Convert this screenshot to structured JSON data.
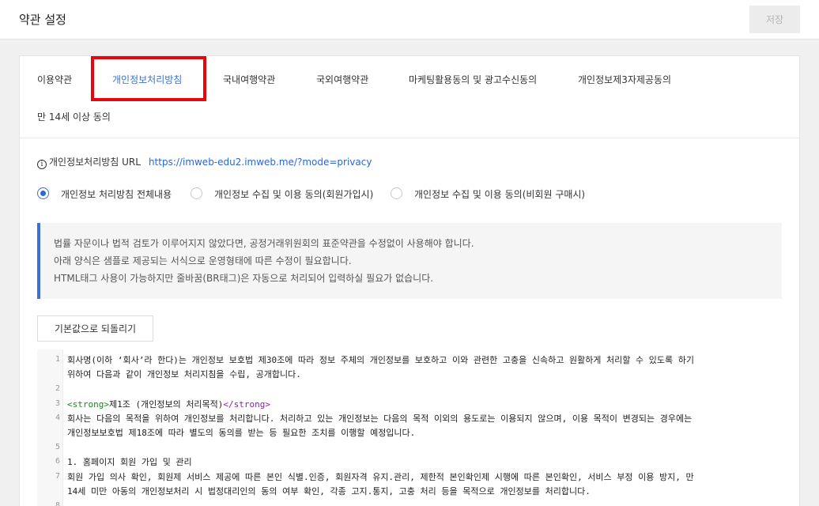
{
  "header": {
    "title": "약관 설정",
    "save_label": "저장"
  },
  "tabs": [
    {
      "label": "이용약관"
    },
    {
      "label": "개인정보처리방침"
    },
    {
      "label": "국내여행약관"
    },
    {
      "label": "국외여행약관"
    },
    {
      "label": "마케팅활용동의 및 광고수신동의"
    },
    {
      "label": "개인정보제3자제공동의"
    },
    {
      "label": "만 14세 이상 동의"
    }
  ],
  "policy_url": {
    "label": "개인정보처리방침 URL",
    "info_glyph": "i",
    "link": "https://imweb-edu2.imweb.me/?mode=privacy"
  },
  "radio_options": [
    {
      "label": "개인정보 처리방침 전체내용"
    },
    {
      "label": "개인정보 수집 및 이용 동의(회원가입시)"
    },
    {
      "label": "개인정보 수집 및 이용 동의(비회원 구매시)"
    }
  ],
  "notice_lines": [
    "법률 자문이나 법적 검토가 이루어지지 않았다면, 공정거래위원회의 표준약관을 수정없이 사용해야 합니다.",
    "아래 양식은 샘플로 제공되는 서식으로 운영형태에 따른 수정이 필요합니다.",
    "HTML태그 사용이 가능하지만 줄바꿈(BR태그)은 자동으로 처리되어 입력하실 필요가 없습니다."
  ],
  "reset_label": "기본값으로 되돌리기",
  "editor": {
    "line_numbers": [
      "1",
      "2",
      "3",
      "4",
      "5",
      "6",
      "7",
      "8"
    ],
    "line1a": "회사명(이하 ‘회사’라 한다)는 개인정보 보호법 제30조에 따라 정보 주체의 개인정보를 보호하고 이와 관련한 고충을 신속하고 원활하게 처리할 수 있도록 하기",
    "line1b": "위하여 다음과 같이 개인정보 처리지침을 수립, 공개합니다.",
    "line3_open": "<strong>",
    "line3_text": "제1조 (개인정보의 처리목적)",
    "line3_close": "</strong>",
    "line4a": "회사는 다음의 목적을 위하여 개인정보를 처리합니다. 처리하고 있는 개인정보는 다음의 목적 이외의 용도로는 이용되지 않으며, 이용 목적이 변경되는 경우에는",
    "line4b": "개인정보보호법 제18조에 따라 별도의 동의를 받는 등 필요한 조치를 이행할 예정입니다.",
    "line6": "1. 홈페이지 회원 가입 및 관리",
    "line7a": "회원 가입 의사 확인, 회원제 서비스 제공에 따른 본인 식별.인증, 회원자격 유지.관리, 제한적 본인확인제 시행에 따른 본인확인, 서비스 부정 이용 방지, 만",
    "line7b": "14세 미만 아동의 개인정보처리 시 법정대리인의 동의 여부 확인, 각종 고지.통지, 고충 처리 등을 목적으로 개인정보를 처리합니다."
  }
}
